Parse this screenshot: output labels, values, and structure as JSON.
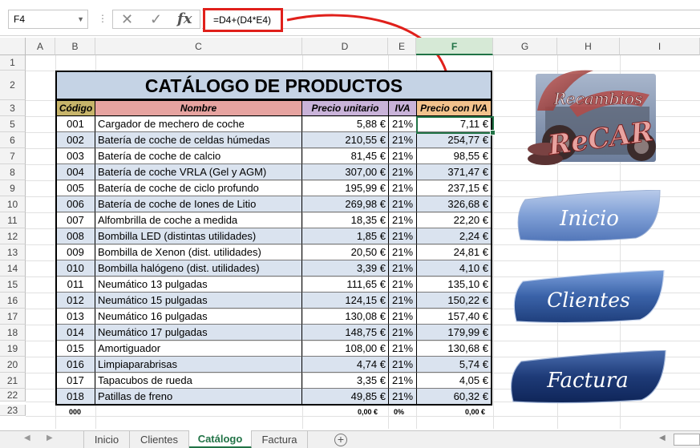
{
  "formula_bar": {
    "name_box": "F4",
    "separator": "⋮",
    "cancel_icon": "✕",
    "enter_icon": "✓",
    "fx_label": "fx",
    "formula": "=D4+(D4*E4)"
  },
  "columns": [
    "A",
    "B",
    "C",
    "D",
    "E",
    "F",
    "G",
    "H",
    "I"
  ],
  "rows": [
    "1",
    "2",
    "3",
    "4",
    "5",
    "6",
    "7",
    "8",
    "9",
    "10",
    "11",
    "12",
    "13",
    "14",
    "15",
    "16",
    "17",
    "18",
    "19",
    "20",
    "21",
    "22",
    "23"
  ],
  "table": {
    "title": "CATÁLOGO DE PRODUCTOS",
    "headers": {
      "code": "Código",
      "name": "Nombre",
      "unit_price": "Precio unitario",
      "iva": "IVA",
      "price_with_iva": "Precio con IVA"
    },
    "header_colors": {
      "code": "#c7b46a",
      "name": "#e6a3a0",
      "unit_price": "#c9b3d9",
      "iva": "#c9b3d9",
      "price_with_iva": "#f2c28c"
    },
    "rows": [
      {
        "code": "001",
        "name": "Cargador de mechero de coche",
        "price": "5,88 €",
        "iva": "21%",
        "total": "7,11 €"
      },
      {
        "code": "002",
        "name": "Batería de coche de celdas húmedas",
        "price": "210,55 €",
        "iva": "21%",
        "total": "254,77 €"
      },
      {
        "code": "003",
        "name": "Batería de coche de calcio",
        "price": "81,45 €",
        "iva": "21%",
        "total": "98,55 €"
      },
      {
        "code": "004",
        "name": "Batería de coche VRLA (Gel y AGM)",
        "price": "307,00 €",
        "iva": "21%",
        "total": "371,47 €"
      },
      {
        "code": "005",
        "name": "Batería de coche de ciclo profundo",
        "price": "195,99 €",
        "iva": "21%",
        "total": "237,15 €"
      },
      {
        "code": "006",
        "name": "Batería de coche de Iones de Litio",
        "price": "269,98 €",
        "iva": "21%",
        "total": "326,68 €"
      },
      {
        "code": "007",
        "name": "Alfombrilla de coche a medida",
        "price": "18,35 €",
        "iva": "21%",
        "total": "22,20 €"
      },
      {
        "code": "008",
        "name": "Bombilla LED (distintas utilidades)",
        "price": "1,85 €",
        "iva": "21%",
        "total": "2,24 €"
      },
      {
        "code": "009",
        "name": "Bombilla de Xenon (dist. utilidades)",
        "price": "20,50 €",
        "iva": "21%",
        "total": "24,81 €"
      },
      {
        "code": "010",
        "name": "Bombilla halógeno (dist. utilidades)",
        "price": "3,39 €",
        "iva": "21%",
        "total": "4,10 €"
      },
      {
        "code": "011",
        "name": "Neumático 13 pulgadas",
        "price": "111,65 €",
        "iva": "21%",
        "total": "135,10 €"
      },
      {
        "code": "012",
        "name": "Neumático 15 pulgadas",
        "price": "124,15 €",
        "iva": "21%",
        "total": "150,22 €"
      },
      {
        "code": "013",
        "name": "Neumático 16 pulgadas",
        "price": "130,08 €",
        "iva": "21%",
        "total": "157,40 €"
      },
      {
        "code": "014",
        "name": "Neumático 17 pulgadas",
        "price": "148,75 €",
        "iva": "21%",
        "total": "179,99 €"
      },
      {
        "code": "015",
        "name": "Amortiguador",
        "price": "108,00 €",
        "iva": "21%",
        "total": "130,68 €"
      },
      {
        "code": "016",
        "name": "Limpiaparabrisas",
        "price": "4,74 €",
        "iva": "21%",
        "total": "5,74 €"
      },
      {
        "code": "017",
        "name": "Tapacubos de rueda",
        "price": "3,35 €",
        "iva": "21%",
        "total": "4,05 €"
      },
      {
        "code": "018",
        "name": "Patillas de freno",
        "price": "49,85 €",
        "iva": "21%",
        "total": "60,32 €"
      }
    ],
    "blank_row": {
      "code": "000",
      "price": "0,00 €",
      "iva": "0%",
      "total": "0,00 €"
    }
  },
  "logo": {
    "line1": "Recambios",
    "line2": "ReCAR"
  },
  "nav_buttons": [
    {
      "label": "Inicio"
    },
    {
      "label": "Clientes"
    },
    {
      "label": "Factura"
    }
  ],
  "sheet_tabs": [
    "Inicio",
    "Clientes",
    "Catálogo",
    "Factura"
  ],
  "active_tab": "Catálogo",
  "colors": {
    "accent": "#217346",
    "annotation_red": "#e0201b",
    "title_bg": "#c5d3e5",
    "alt_row": "#dae3ef",
    "button_blue": "#3a62a8"
  }
}
